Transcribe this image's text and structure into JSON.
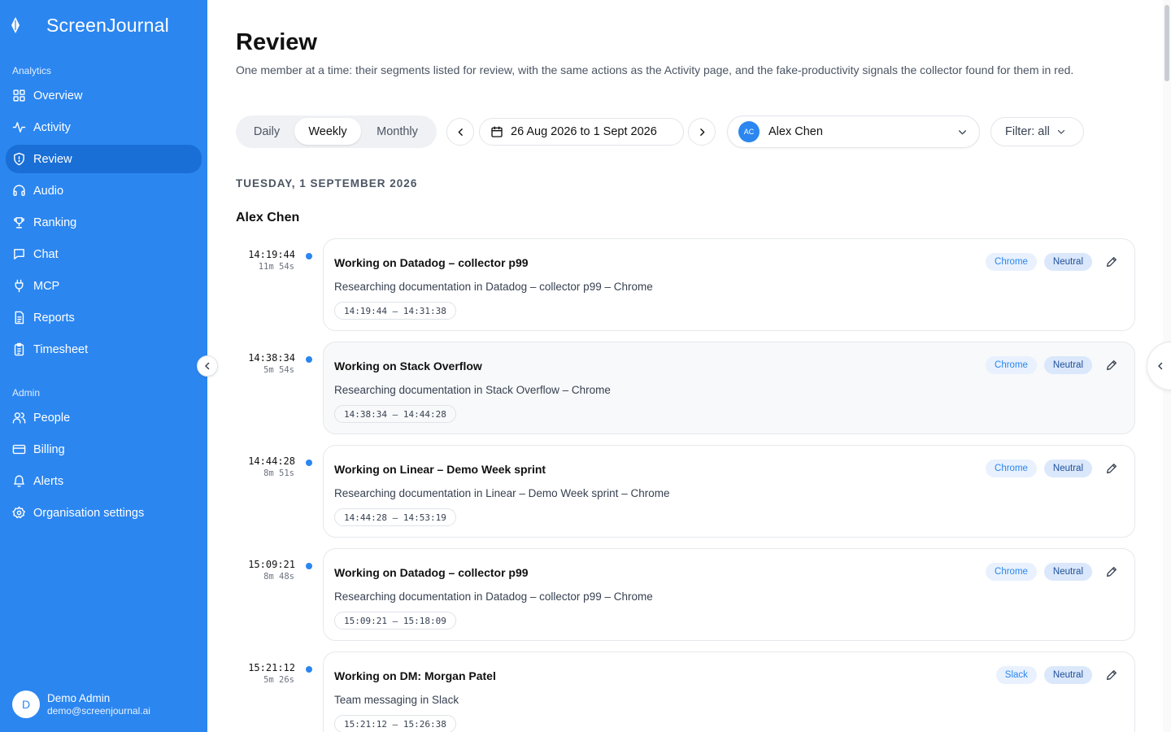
{
  "app": {
    "name": "ScreenJournal"
  },
  "sidebar": {
    "analytics_label": "Analytics",
    "admin_label": "Admin",
    "analytics_items": [
      {
        "label": "Overview",
        "icon": "grid-icon"
      },
      {
        "label": "Activity",
        "icon": "activity-icon"
      },
      {
        "label": "Review",
        "icon": "shield-icon",
        "active": true
      },
      {
        "label": "Audio",
        "icon": "headphones-icon"
      },
      {
        "label": "Ranking",
        "icon": "trophy-icon"
      },
      {
        "label": "Chat",
        "icon": "chat-icon"
      },
      {
        "label": "MCP",
        "icon": "plug-icon"
      },
      {
        "label": "Reports",
        "icon": "document-icon"
      },
      {
        "label": "Timesheet",
        "icon": "clipboard-icon"
      }
    ],
    "admin_items": [
      {
        "label": "People",
        "icon": "users-icon"
      },
      {
        "label": "Billing",
        "icon": "credit-card-icon"
      },
      {
        "label": "Alerts",
        "icon": "bell-icon"
      },
      {
        "label": "Organisation settings",
        "icon": "gear-icon"
      }
    ],
    "user": {
      "initial": "D",
      "name": "Demo Admin",
      "email": "demo@screenjournal.ai"
    }
  },
  "page": {
    "title": "Review",
    "description": "One member at a time: their segments listed for review, with the same actions as the Activity page, and the fake-productivity signals the collector found for them in red."
  },
  "toolbar": {
    "periods": [
      "Daily",
      "Weekly",
      "Monthly"
    ],
    "selected_period": "Weekly",
    "date_range": "26 Aug 2026 to 1 Sept 2026",
    "member": {
      "initials": "AC",
      "name": "Alex Chen"
    },
    "filter_label": "Filter: all"
  },
  "day_header": "TUESDAY, 1 SEPTEMBER 2026",
  "member_heading": "Alex Chen",
  "segments": [
    {
      "time": "14:19:44",
      "duration": "11m 54s",
      "title": "Working on Datadog – collector p99",
      "subtitle": "Researching documentation in Datadog – collector p99 – Chrome",
      "range": "14:19:44 – 14:31:38",
      "app": "Chrome",
      "category": "Neutral"
    },
    {
      "time": "14:38:34",
      "duration": "5m 54s",
      "title": "Working on Stack Overflow",
      "subtitle": "Researching documentation in Stack Overflow – Chrome",
      "range": "14:38:34 – 14:44:28",
      "app": "Chrome",
      "category": "Neutral"
    },
    {
      "time": "14:44:28",
      "duration": "8m 51s",
      "title": "Working on Linear – Demo Week sprint",
      "subtitle": "Researching documentation in Linear – Demo Week sprint – Chrome",
      "range": "14:44:28 – 14:53:19",
      "app": "Chrome",
      "category": "Neutral"
    },
    {
      "time": "15:09:21",
      "duration": "8m 48s",
      "title": "Working on Datadog – collector p99",
      "subtitle": "Researching documentation in Datadog – collector p99 – Chrome",
      "range": "15:09:21 – 15:18:09",
      "app": "Chrome",
      "category": "Neutral"
    },
    {
      "time": "15:21:12",
      "duration": "5m 26s",
      "title": "Working on DM: Morgan Patel",
      "subtitle": "Team messaging in Slack",
      "range": "15:21:12 – 15:26:38",
      "app": "Slack",
      "category": "Neutral"
    }
  ]
}
